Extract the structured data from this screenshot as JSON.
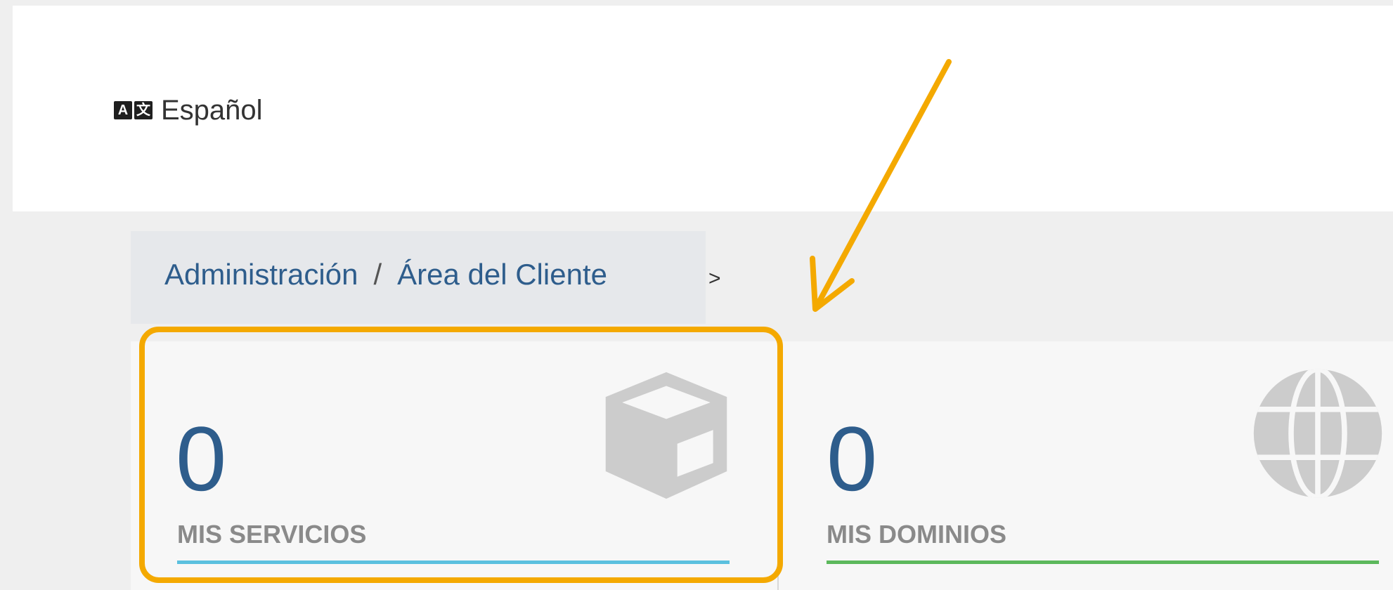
{
  "language": {
    "icon": "translate-icon",
    "icon_glyphs": [
      "A",
      "文"
    ],
    "label": "Español"
  },
  "breadcrumb": {
    "items": [
      "Administración",
      "Área del Cliente"
    ],
    "separator": "/",
    "trailing": ">"
  },
  "cards": [
    {
      "count": "0",
      "label": "MIS SERVICIOS",
      "icon": "box-icon",
      "accent": "#5bc0de"
    },
    {
      "count": "0",
      "label": "MIS DOMINIOS",
      "icon": "globe-icon",
      "accent": "#5cb85c"
    }
  ],
  "annotation": {
    "color": "#f4a900",
    "arrow": "arrow-icon",
    "highlight": "MIS SERVICIOS card"
  },
  "colors": {
    "link": "#2e5d8c",
    "icon_gray": "#cccccc"
  }
}
